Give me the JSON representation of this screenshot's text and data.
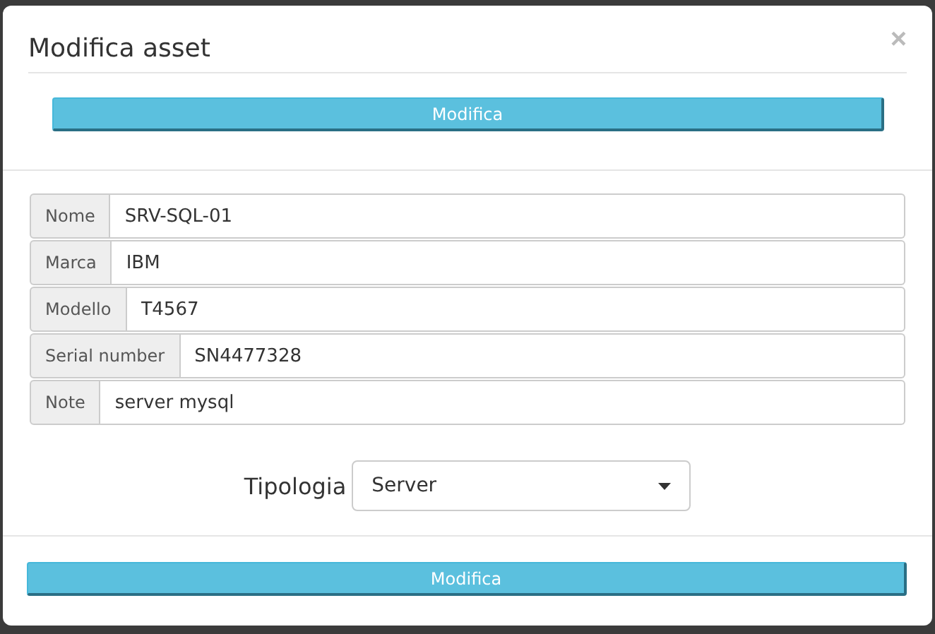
{
  "modal": {
    "title": "Modifica asset",
    "close": "×",
    "top_button": "Modifica"
  },
  "fields": [
    {
      "label": "Nome",
      "value": "SRV-SQL-01"
    },
    {
      "label": "Marca",
      "value": "IBM"
    },
    {
      "label": "Modello",
      "value": "T4567"
    },
    {
      "label": "Serial number",
      "value": "SN4477328"
    },
    {
      "label": "Note",
      "value": "server mysql"
    }
  ],
  "tipologia": {
    "label": "Tipologia",
    "value": "Server"
  },
  "footer_button": "Modifica"
}
